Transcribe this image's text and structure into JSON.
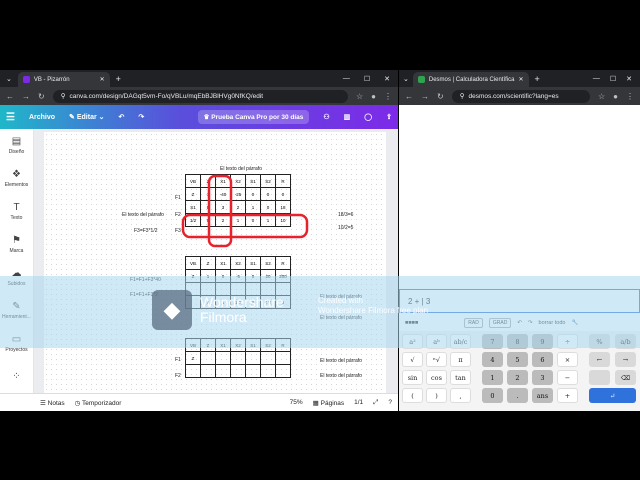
{
  "left_window": {
    "tab_title": "VB - Pizarrón",
    "url": "canva.com/design/DAGqt5vm-Fo/qVBLu/mqEbBJBlHVg0NfKQ/edit",
    "canva_toolbar": {
      "menu_file": "Archivo",
      "edit_label": "Editar",
      "pro_trial": "Prueba Canva Pro por 30 días"
    },
    "sidebar": [
      {
        "label": "Diseño"
      },
      {
        "label": "Elementos"
      },
      {
        "label": "Texto"
      },
      {
        "label": "Marca"
      },
      {
        "label": "Subidos"
      },
      {
        "label": "Herramient..."
      },
      {
        "label": "Proyectos"
      }
    ],
    "canvas": {
      "caption": "El texto del párrafo",
      "table1_header": [
        "VB",
        "Z",
        "X1",
        "X2",
        "S1",
        "S2",
        "R"
      ],
      "table1_rows": [
        [
          "Z",
          "1",
          "-40",
          "-25",
          "0",
          "0",
          "0"
        ],
        [
          "S1",
          "0",
          "3",
          "2",
          "1",
          "0",
          "18"
        ],
        [
          "1/2",
          "0",
          "2",
          "1",
          "0",
          "1",
          "10"
        ]
      ],
      "row_labels": [
        "F1",
        "F2",
        "F3"
      ],
      "left_note_1": "El texto del párrafo",
      "left_note_2": "F3=F3*1/2",
      "ratio_1": "18/3=6",
      "ratio_2": "10/2=5",
      "table2_header": [
        "VB",
        "Z",
        "X1",
        "X2",
        "S1",
        "S2",
        "R"
      ],
      "table2_rows": [
        [
          "Z",
          "1",
          "0",
          "-5",
          "0",
          "20",
          "200"
        ],
        [
          "",
          "",
          "",
          "",
          "",
          "",
          ""
        ],
        [
          "",
          "0",
          "1",
          "1/2",
          "0",
          "1/2",
          "5"
        ]
      ],
      "formula_1": "F1=F1+F3*40",
      "formula_2": "F1=F1+F3*2",
      "right_text": "El texto del párrafo",
      "table3_header": [
        "VB",
        "Z",
        "X1",
        "X2",
        "S1",
        "S2",
        "R"
      ],
      "table3_rows": [
        [
          "Z",
          "",
          "",
          "",
          "",
          "",
          ""
        ],
        [
          "",
          "",
          "",
          "",
          "",
          "",
          ""
        ]
      ],
      "bottom_labels": [
        "F1",
        "F2"
      ]
    },
    "bottom_bar": {
      "notes": "Notas",
      "timer": "Temporizador",
      "zoom": "75%",
      "pages": "Páginas",
      "page_count": "1/1"
    }
  },
  "right_window": {
    "tab_title": "Desmos | Calculadora Científica",
    "url": "desmos.com/scientific?lang=es",
    "expression": "2 + | 3",
    "keypad_top": {
      "rad": "RAD",
      "grad": "GRAD",
      "clear_all": "borrar todo"
    },
    "keys": [
      {
        "label": "a²",
        "kind": "w"
      },
      {
        "label": "aᵇ",
        "kind": "w"
      },
      {
        "label": "ab/c",
        "kind": "w"
      },
      {
        "label": "7",
        "kind": "d"
      },
      {
        "label": "8",
        "kind": "d"
      },
      {
        "label": "9",
        "kind": "d"
      },
      {
        "label": "÷",
        "kind": "w"
      },
      {
        "label": "%",
        "kind": "g"
      },
      {
        "label": "a/b",
        "kind": "g"
      },
      {
        "label": "√",
        "kind": "w"
      },
      {
        "label": "ⁿ√",
        "kind": "w"
      },
      {
        "label": "π",
        "kind": "w"
      },
      {
        "label": "4",
        "kind": "d"
      },
      {
        "label": "5",
        "kind": "d"
      },
      {
        "label": "6",
        "kind": "d"
      },
      {
        "label": "×",
        "kind": "w"
      },
      {
        "label": "←",
        "kind": "g"
      },
      {
        "label": "→",
        "kind": "g"
      },
      {
        "label": "sin",
        "kind": "w"
      },
      {
        "label": "cos",
        "kind": "w"
      },
      {
        "label": "tan",
        "kind": "w"
      },
      {
        "label": "1",
        "kind": "d"
      },
      {
        "label": "2",
        "kind": "d"
      },
      {
        "label": "3",
        "kind": "d"
      },
      {
        "label": "−",
        "kind": "w"
      },
      {
        "label": "",
        "kind": "g"
      },
      {
        "label": "⌫",
        "kind": "g"
      },
      {
        "label": "(",
        "kind": "w"
      },
      {
        "label": ")",
        "kind": "w"
      },
      {
        "label": ",",
        "kind": "w"
      },
      {
        "label": "0",
        "kind": "d"
      },
      {
        "label": ".",
        "kind": "d"
      },
      {
        "label": "ans",
        "kind": "d"
      },
      {
        "label": "+",
        "kind": "w"
      },
      {
        "label": "",
        "kind": "b"
      },
      {
        "label": "↵",
        "kind": "b"
      }
    ]
  },
  "watermark": {
    "brand": "Wondershare",
    "product": "Filmora",
    "free_line_1": "Created with",
    "free_line_2": "Wondershare Filmora free plan"
  },
  "colors": {
    "highlight_red": "#e8222c",
    "desmos_blue": "#2f72dc",
    "chrome_dark": "#202124"
  }
}
